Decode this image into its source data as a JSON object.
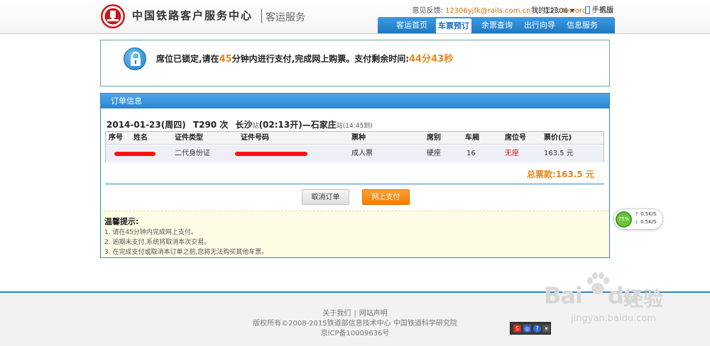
{
  "header": {
    "logo_text": "中国铁路客户服务中心",
    "logo_sub": "客运服务",
    "feedback_label": "意见反馈:",
    "feedback_email": "12306yjfk@rails.com.cn",
    "greeting": "您好,",
    "username": "teword",
    "logout": "退出",
    "my12306": "我的12306",
    "mobile": "手机版",
    "nav": [
      {
        "label": "客运首页",
        "active": false
      },
      {
        "label": "车票预订",
        "active": true
      },
      {
        "label": "余票查询",
        "active": false
      },
      {
        "label": "出行向导",
        "active": false
      },
      {
        "label": "信息服务",
        "active": false
      }
    ]
  },
  "lock": {
    "msg_prefix": "席位已锁定,请在",
    "minutes": "45",
    "msg_mid": "分钟内进行支付,完成网上购票。支付剩余时间:",
    "remaining": "44分43秒"
  },
  "order": {
    "panel_title": "订单信息",
    "date": "2014-01-23(周四)",
    "train": "T290 次",
    "from": "长沙",
    "station_suffix": "站",
    "depart": "(02:13开)",
    "dash": "—",
    "to": "石家庄",
    "arrive": "(14:45到)",
    "columns": [
      "序号",
      "姓名",
      "证件类型",
      "证件号码",
      "票种",
      "席别",
      "车厢",
      "席位号",
      "票价(元)"
    ],
    "rows": [
      {
        "index": "",
        "name": "",
        "id_type": "二代身份证",
        "id_number": "",
        "ticket_type": "成人票",
        "seat_class": "硬座",
        "car": "16",
        "seat_no": "无座",
        "price": "163.5 元"
      }
    ],
    "total_label": "总票款:",
    "total_value": "163.5 元",
    "cancel_button": "取消订单",
    "pay_button": "网上支付"
  },
  "tips": {
    "title": "温馨提示:",
    "items": [
      "1. 请在45分钟内完成网上支付。",
      "2. 逾期未支付,系统将取消本次交易。",
      "3. 在完成支付或取消本订单之前,您将无法购买其他车票。"
    ]
  },
  "footer": {
    "about": "关于我们",
    "statement": "网站声明",
    "copyright": "版权所有©2008-2015铁道部信息技术中心   中国铁道科学研究院",
    "icp": "京ICP备10009636号"
  },
  "speed_widget": {
    "percent": "75%",
    "upload": "0.5K/S",
    "download": "0.5K/S"
  },
  "watermark": {
    "brand": "Bai",
    "brand2": "du",
    "product": "经验",
    "url": "jingyan.baidu.com"
  },
  "colors": {
    "brand_red": "#c8161d",
    "nav_blue": "#2c85cd",
    "accent_orange": "#e7861b",
    "pay_orange": "#f57d00"
  }
}
